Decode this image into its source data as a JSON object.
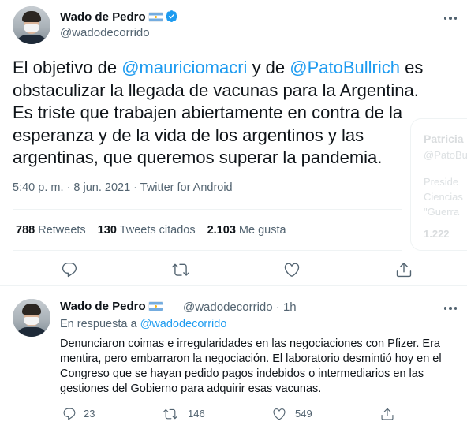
{
  "sidebar_card": {
    "name": "Patricia",
    "handle": "@PatoBu",
    "bio_line1": "Preside",
    "bio_line2": "Ciencias",
    "bio_line3": "\"Guerra",
    "stat": "1.222"
  },
  "tweet": {
    "author_name": "Wado de Pedro",
    "author_handle": "@wadodecorrido",
    "text_1": "El objetivo de ",
    "mention_1": "@mauriciomacri",
    "text_2": " y de ",
    "mention_2": "@PatoBullrich",
    "text_3": " es obstaculizar la llegada de vacunas para la Argentina. Es triste que trabajen abiertamente en contra de la esperanza y de la vida de los argentinos y las argentinas, que queremos superar la pandemia.",
    "time": "5:40 p. m.",
    "date": "8 jun. 2021",
    "source": "Twitter for Android",
    "stats": {
      "retweets_count": "788",
      "retweets_label": "Retweets",
      "quotes_count": "130",
      "quotes_label": "Tweets citados",
      "likes_count": "2.103",
      "likes_label": "Me gusta"
    }
  },
  "reply": {
    "author_name": "Wado de Pedro",
    "author_handle": "@wadodecorrido",
    "time": "1h",
    "reply_prefix": "En respuesta a ",
    "reply_to": "@wadodecorrido",
    "text": "Denunciaron coimas e irregularidades en las negociaciones con Pfizer. Era mentira, pero embarraron la negociación. El laboratorio desmintió hoy en el Congreso que se hayan pedido pagos indebidos o intermediarios en las gestiones del Gobierno para adquirir esas vacunas.",
    "replies": "23",
    "retweets": "146",
    "likes": "549"
  },
  "icons": {
    "verified": "verified-badge-icon",
    "flag": "argentina-flag-icon",
    "reply": "reply-icon",
    "retweet": "retweet-icon",
    "like": "heart-icon",
    "share": "share-icon",
    "more": "more-icon"
  },
  "colors": {
    "accent": "#1d9bf0",
    "text": "#0f1419",
    "secondary": "#536471"
  }
}
